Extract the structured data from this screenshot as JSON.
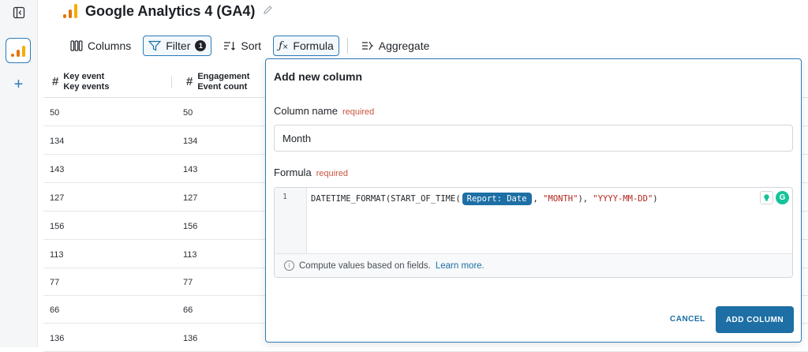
{
  "app": {
    "title": "Google Analytics 4 (GA4)",
    "logo_colors": [
      "#f9ab00",
      "#e37400"
    ]
  },
  "toolbar": {
    "columns_label": "Columns",
    "filter_label": "Filter",
    "filter_count": "1",
    "sort_label": "Sort",
    "formula_label": "Formula",
    "aggregate_label": "Aggregate"
  },
  "table": {
    "columns": [
      {
        "type": "#",
        "line1": "Key event",
        "line2": "Key events"
      },
      {
        "type": "#",
        "line1": "Engagement",
        "line2": "Event count"
      }
    ],
    "rows": [
      {
        "c1": "50",
        "c2": "50",
        "c9": ""
      },
      {
        "c1": "134",
        "c2": "134",
        "c9": ""
      },
      {
        "c1": "143",
        "c2": "143",
        "c9": ""
      },
      {
        "c1": "127",
        "c2": "127",
        "c9": ""
      },
      {
        "c1": "156",
        "c2": "156",
        "c9": ""
      },
      {
        "c1": "113",
        "c2": "113",
        "c9": ""
      },
      {
        "c1": "77",
        "c2": "77",
        "c9": ""
      },
      {
        "c1": "66",
        "c2": "66",
        "c9": ""
      },
      {
        "c1": "136",
        "c2": "136",
        "c9": ""
      }
    ]
  },
  "modal": {
    "title": "Add new column",
    "column_name_label": "Column name",
    "required": "required",
    "column_name_value": "Month",
    "formula_label": "Formula",
    "line_number": "1",
    "code_prefix": "DATETIME_FORMAT(START_OF_TIME(",
    "code_token": "Report: Date",
    "code_mid": ", ",
    "code_str1": "\"MONTH\"",
    "code_sep": "), ",
    "code_str2": "\"YYYY-MM-DD\"",
    "code_suffix": ")",
    "hint_text": "Compute values based on fields.",
    "hint_link": "Learn more.",
    "cancel_label": "CANCEL",
    "add_label": "ADD COLUMN"
  },
  "colors": {
    "accent": "#1d6fa5",
    "required": "#c8553d",
    "grammarly": "#15c39a"
  }
}
